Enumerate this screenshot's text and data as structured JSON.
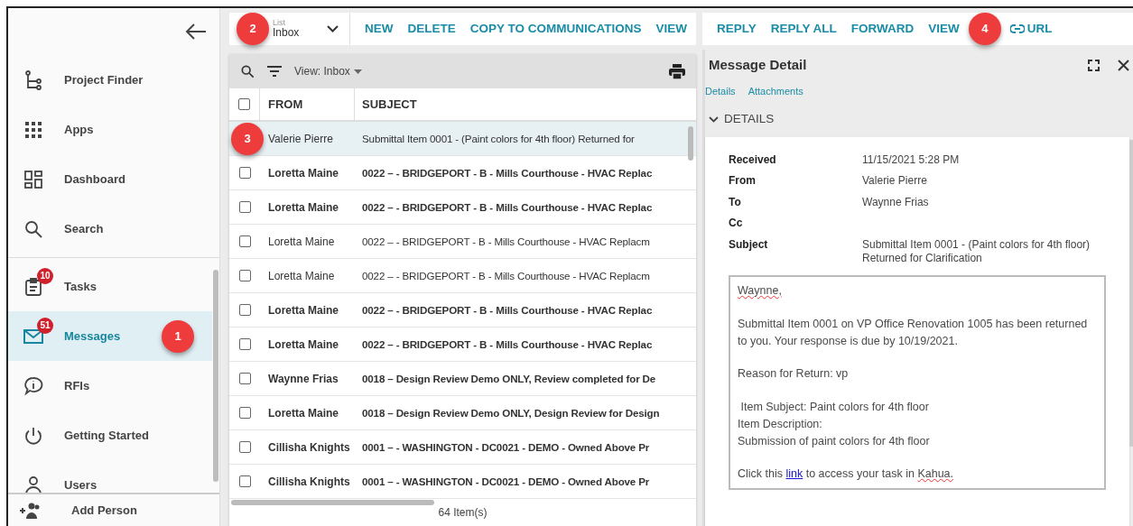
{
  "sidebar": {
    "groups": [
      [
        {
          "label": "Project Finder",
          "selected": false
        },
        {
          "label": "Apps",
          "selected": false
        },
        {
          "label": "Dashboard",
          "selected": false
        },
        {
          "label": "Search",
          "selected": false
        }
      ],
      [
        {
          "label": "Tasks",
          "badge": "10",
          "selected": false
        },
        {
          "label": "Messages",
          "badge": "51",
          "selected": true,
          "callout": "1"
        },
        {
          "label": "RFIs",
          "selected": false
        },
        {
          "label": "Getting Started",
          "selected": false
        },
        {
          "label": "Users",
          "selected": false
        }
      ]
    ],
    "footer": {
      "label": "Add Person"
    }
  },
  "list_toolbar": {
    "dropdown": {
      "caption": "List",
      "value": "Inbox",
      "callout": "2"
    },
    "actions": [
      "NEW",
      "DELETE",
      "COPY TO COMMUNICATIONS",
      "VIEW"
    ]
  },
  "detail_toolbar": {
    "actions": [
      {
        "label": "REPLY"
      },
      {
        "label": "REPLY ALL"
      },
      {
        "label": "FORWARD"
      },
      {
        "label": "VIEW"
      },
      {
        "label": "URL",
        "callout": "4"
      }
    ]
  },
  "grid": {
    "view_label": "View: Inbox",
    "columns": [
      "FROM",
      "SUBJECT"
    ],
    "header_checked": false,
    "rows": [
      {
        "from": "Valerie Pierre",
        "subject": "Submittal Item 0001 - (Paint colors for 4th floor) Returned for",
        "unread": false,
        "selected": true,
        "callout": "3"
      },
      {
        "from": "Loretta Maine",
        "subject": "0022 –  - BRIDGEPORT - B - Mills Courthouse - HVAC Replac",
        "unread": true,
        "selected": false,
        "checked": false
      },
      {
        "from": "Loretta Maine",
        "subject": "0022 –  - BRIDGEPORT - B - Mills Courthouse - HVAC Replac",
        "unread": true,
        "selected": false,
        "checked": false
      },
      {
        "from": "Loretta Maine",
        "subject": "0022 –  - BRIDGEPORT - B - Mills Courthouse - HVAC Replacm",
        "unread": false,
        "selected": false,
        "checked": false
      },
      {
        "from": "Loretta Maine",
        "subject": "0022 –  - BRIDGEPORT - B - Mills Courthouse - HVAC Replacm",
        "unread": false,
        "selected": false,
        "checked": false
      },
      {
        "from": "Loretta Maine",
        "subject": "0022 –  - BRIDGEPORT - B - Mills Courthouse - HVAC Replac",
        "unread": true,
        "selected": false,
        "checked": false
      },
      {
        "from": "Loretta Maine",
        "subject": "0022 –  - BRIDGEPORT - B - Mills Courthouse - HVAC Replac",
        "unread": true,
        "selected": false,
        "checked": false
      },
      {
        "from": "Waynne Frias",
        "subject": "0018 – Design Review Demo ONLY, Review completed for De",
        "unread": true,
        "selected": false,
        "checked": false
      },
      {
        "from": "Loretta Maine",
        "subject": "0018 – Design Review Demo ONLY, Design Review for Design",
        "unread": true,
        "selected": false,
        "checked": false
      },
      {
        "from": "Cillisha Knights",
        "subject": "0001 –  - WASHINGTON - DC0021 - DEMO - Owned Above Pr",
        "unread": true,
        "selected": false,
        "checked": false
      },
      {
        "from": "Cillisha Knights",
        "subject": "0001 –  - WASHINGTON - DC0021 - DEMO - Owned Above Pr",
        "unread": true,
        "selected": false,
        "checked": false
      }
    ],
    "item_count": "64 Item(s)"
  },
  "detail": {
    "title": "Message Detail",
    "tabs": [
      "Details",
      "Attachments"
    ],
    "section": {
      "title": "DETAILS",
      "expanded": true
    },
    "fields": [
      {
        "label": "Received",
        "value": "11/15/2021 5:28 PM"
      },
      {
        "label": "From",
        "value": "Valerie Pierre"
      },
      {
        "label": "To",
        "value": "Waynne Frias"
      },
      {
        "label": "Cc"
      },
      {
        "label": "Subject",
        "value": "Submittal Item 0001 - (Paint colors for 4th floor) Returned for Clarification"
      }
    ],
    "body": [
      [
        [
          {
            "kind": "misspelled",
            "text": "Waynne,"
          }
        ]
      ],
      [
        [
          {
            "kind": "plain",
            "text": "Submittal Item 0001 on VP Office Renovation 1005 has been returned to you. Your response is due by 10/19/2021."
          }
        ]
      ],
      [
        [
          {
            "kind": "plain",
            "text": "Reason for Return: vp"
          }
        ]
      ],
      [
        [
          {
            "kind": "plain",
            "text": " Item Subject: Paint colors for 4th floor"
          }
        ],
        [
          {
            "kind": "plain",
            "text": "Item Description:"
          }
        ],
        [
          {
            "kind": "plain",
            "text": "Submission of paint colors for 4th floor"
          }
        ]
      ],
      [
        [
          {
            "kind": "plain",
            "text": "Click this "
          },
          {
            "kind": "link",
            "text": "link"
          },
          {
            "kind": "plain",
            "text": " to access your task in "
          },
          {
            "kind": "misspelled",
            "text": "Kahua."
          }
        ]
      ]
    ]
  }
}
